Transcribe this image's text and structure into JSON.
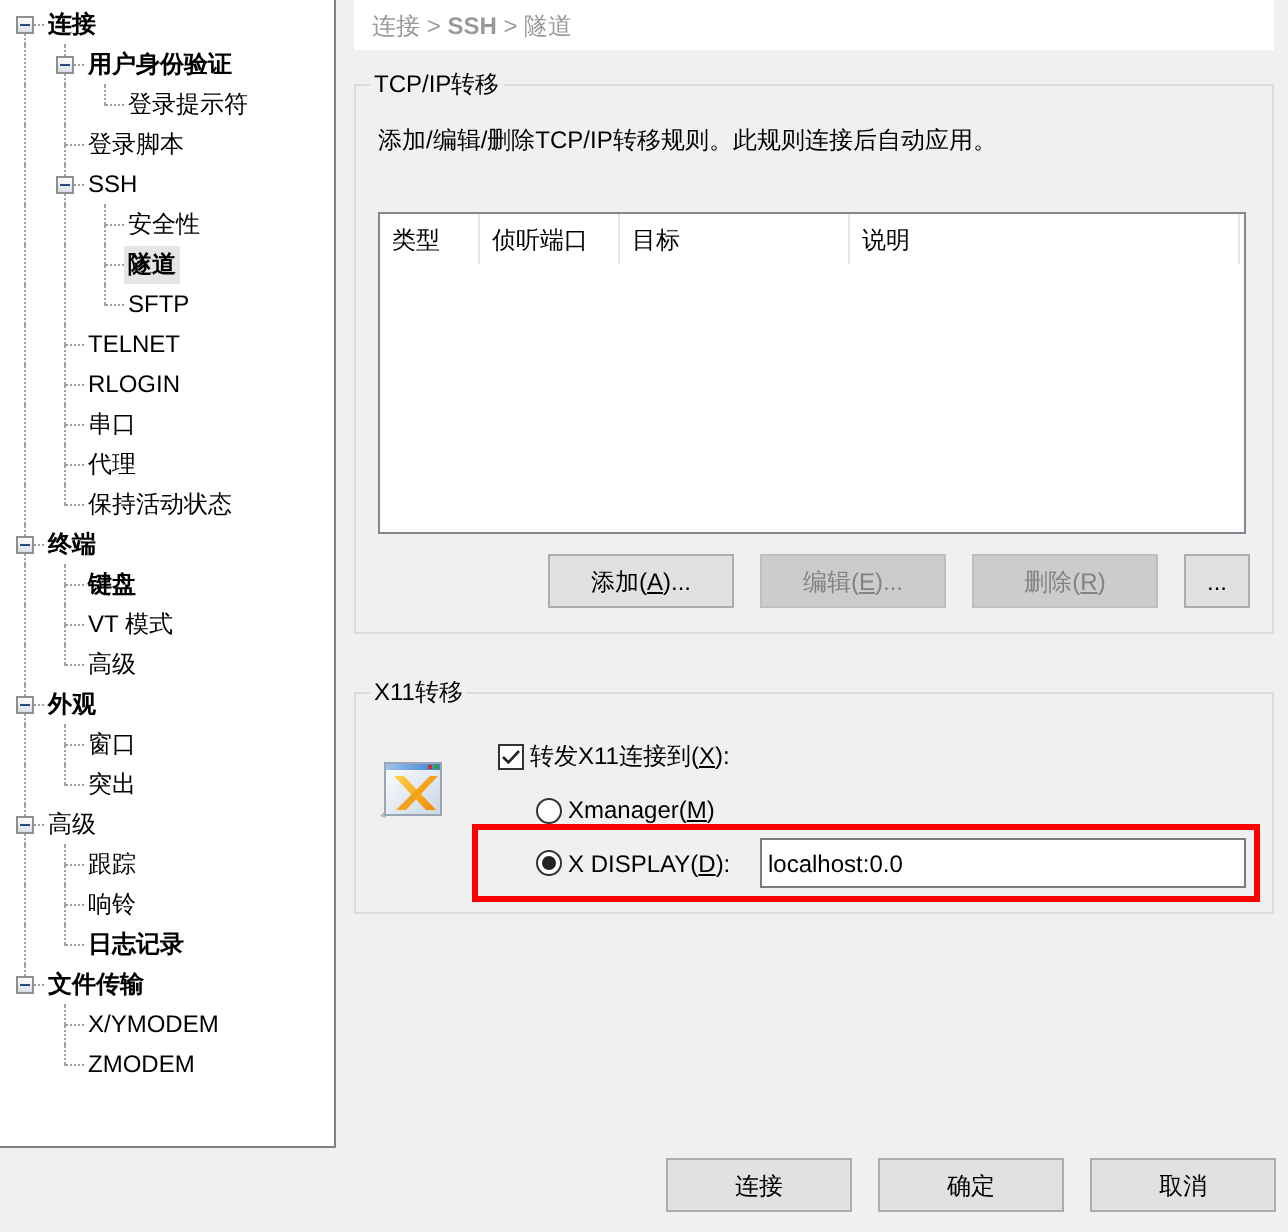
{
  "tree": [
    {
      "label": "连接",
      "bold": true,
      "selected": false,
      "expanded": true,
      "children": [
        {
          "label": "用户身份验证",
          "bold": true,
          "selected": false,
          "expanded": true,
          "children": [
            {
              "label": "登录提示符",
              "bold": false,
              "selected": false
            }
          ]
        },
        {
          "label": "登录脚本",
          "bold": false,
          "selected": false
        },
        {
          "label": "SSH",
          "bold": false,
          "selected": false,
          "expanded": true,
          "children": [
            {
              "label": "安全性",
              "bold": false,
              "selected": false
            },
            {
              "label": "隧道",
              "bold": true,
              "selected": true
            },
            {
              "label": "SFTP",
              "bold": false,
              "selected": false
            }
          ]
        },
        {
          "label": "TELNET",
          "bold": false,
          "selected": false
        },
        {
          "label": "RLOGIN",
          "bold": false,
          "selected": false
        },
        {
          "label": "串口",
          "bold": false,
          "selected": false
        },
        {
          "label": "代理",
          "bold": false,
          "selected": false
        },
        {
          "label": "保持活动状态",
          "bold": false,
          "selected": false
        }
      ]
    },
    {
      "label": "终端",
      "bold": true,
      "selected": false,
      "expanded": true,
      "children": [
        {
          "label": "键盘",
          "bold": true,
          "selected": false
        },
        {
          "label": "VT 模式",
          "bold": false,
          "selected": false
        },
        {
          "label": "高级",
          "bold": false,
          "selected": false
        }
      ]
    },
    {
      "label": "外观",
      "bold": true,
      "selected": false,
      "expanded": true,
      "children": [
        {
          "label": "窗口",
          "bold": false,
          "selected": false
        },
        {
          "label": "突出",
          "bold": false,
          "selected": false
        }
      ]
    },
    {
      "label": "高级",
      "bold": false,
      "selected": false,
      "expanded": true,
      "children": [
        {
          "label": "跟踪",
          "bold": false,
          "selected": false
        },
        {
          "label": "响铃",
          "bold": false,
          "selected": false
        },
        {
          "label": "日志记录",
          "bold": true,
          "selected": false
        }
      ]
    },
    {
      "label": "文件传输",
      "bold": true,
      "selected": false,
      "expanded": true,
      "children": [
        {
          "label": "X/YMODEM",
          "bold": false,
          "selected": false
        },
        {
          "label": "ZMODEM",
          "bold": false,
          "selected": false
        }
      ]
    }
  ],
  "breadcrumb": "连接 > **SSH** > 隧道",
  "tcp_ip_forwarding": {
    "title": "TCP/IP转移",
    "description": "添加/编辑/删除TCP/IP转移规则。此规则连接后自动应用。",
    "columns": [
      "类型",
      "侦听端口",
      "目标",
      "说明"
    ],
    "buttons": [
      {
        "label_parts": [
          "添加(",
          "A",
          ")..."
        ],
        "disabled": false
      },
      {
        "label_parts": [
          "编辑(",
          "E",
          ")..."
        ],
        "disabled": true
      },
      {
        "label_parts": [
          "删除(",
          "R",
          ")"
        ],
        "disabled": true
      },
      {
        "label_parts": [
          "..."
        ],
        "disabled": false
      }
    ]
  },
  "x11_forwarding": {
    "title": "X11转移",
    "checkbox": {
      "label_parts": [
        "转发X11连接到(",
        "X",
        "):"
      ],
      "checked": true
    },
    "options": [
      {
        "label_parts": [
          "Xmanager(",
          "M",
          ")"
        ],
        "selected": false,
        "highlighted": false
      },
      {
        "label_parts": [
          "X DISPLAY(",
          "D",
          "):"
        ],
        "selected": true,
        "highlighted": true,
        "value": "localhost:0.0"
      }
    ]
  },
  "dialog_buttons": [
    {
      "label": "连接"
    },
    {
      "label": "确定"
    },
    {
      "label": "取消"
    }
  ]
}
